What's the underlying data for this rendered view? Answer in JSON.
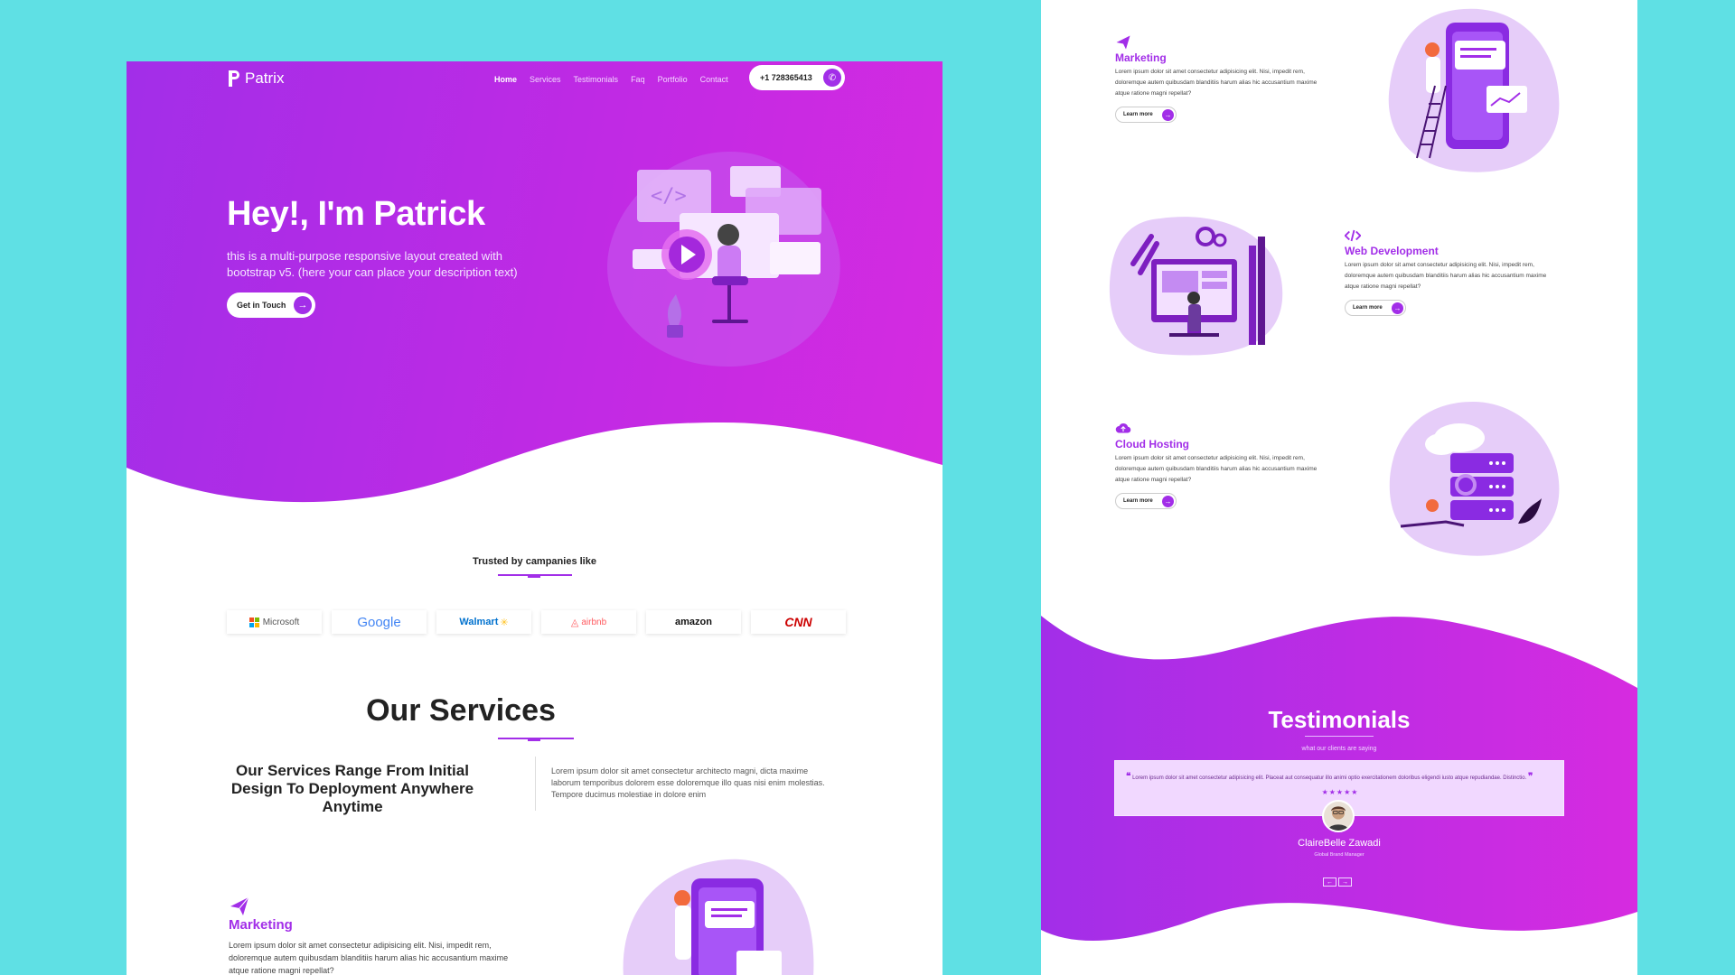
{
  "colors": {
    "background": "#5fe0e4",
    "accent": "#a22ee8",
    "accent_pink": "#d62be0",
    "lavender": "#e6cdf9"
  },
  "left": {
    "nav": {
      "logo": "Patrix",
      "links": [
        "Home",
        "Services",
        "Testimonials",
        "Faq",
        "Portfolio",
        "Contact"
      ],
      "phone": "+1 728365413"
    },
    "hero": {
      "title": "Hey!, I'm Patrick",
      "description": "this is a multi-purpose responsive layout created with bootstrap v5. (here your can place your description text)",
      "cta": "Get in Touch"
    },
    "trusted": {
      "heading": "Trusted by campanies like",
      "brands": [
        "Microsoft",
        "Google",
        "Walmart",
        "airbnb",
        "amazon",
        "CNN"
      ]
    },
    "services": {
      "title": "Our Services",
      "subtitle": "Our Services Range From Initial Design To Deployment Anywhere Anytime",
      "text": "Lorem ipsum dolor sit amet consectetur architecto magni, dicta maxime laborum temporibus dolorem esse doloremque illo quas nisi enim molestias. Tempore ducimus molestiae in dolore enim"
    },
    "marketing": {
      "title": "Marketing",
      "text": "Lorem ipsum dolor sit amet consectetur adipisicing elit. Nisi, impedit rem, doloremque autem quibusdam blanditiis harum alias hic accusantium maxime atque ratione magni repellat?"
    }
  },
  "right": {
    "services": [
      {
        "title": "Marketing",
        "text": "Lorem ipsum dolor sit amet consectetur adipisicing elit. Nisi, impedit rem, doloremque autem quibusdam blanditiis harum alias hic accusantium maxime atque ratione magni repellat?",
        "button": "Learn more",
        "icon": "paper-plane-icon"
      },
      {
        "title": "Web Development",
        "text": "Lorem ipsum dolor sit amet consectetur adipisicing elit. Nisi, impedit rem, doloremque autem quibusdam blanditiis harum alias hic accusantium maxime atque ratione magni repellat?",
        "button": "Learn more",
        "icon": "code-icon"
      },
      {
        "title": "Cloud Hosting",
        "text": "Lorem ipsum dolor sit amet consectetur adipisicing elit. Nisi, impedit rem, doloremque autem quibusdam blanditiis harum alias hic accusantium maxime atque ratione magni repellat?",
        "button": "Learn more",
        "icon": "cloud-upload-icon"
      }
    ],
    "testimonials": {
      "title": "Testimonials",
      "subtitle": "what our clients are saying",
      "quote": "Lorem ipsum dolor sit amet consectetur adipisicing elit. Placeat aut consequatur illo animi optio exercitationem doloribus eligendi iusto atque repudiandae. Distinctio.",
      "stars": "★★★★★",
      "rating": 5,
      "name": "ClaireBelle Zawadi",
      "role": "Global Brand Manager",
      "prev": "←",
      "next": "→"
    }
  }
}
